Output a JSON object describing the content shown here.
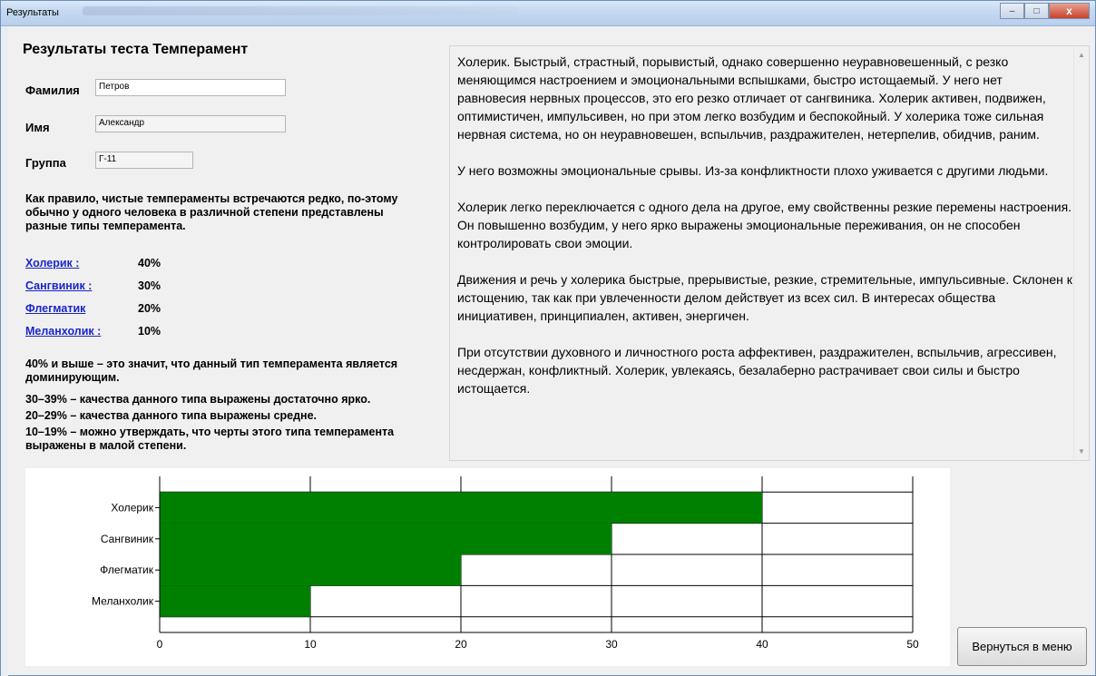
{
  "window": {
    "title": "Результаты",
    "controls": {
      "minimize": "–",
      "maximize": "□",
      "close": "x"
    }
  },
  "form": {
    "heading": "Результаты теста Темперамент",
    "surname_label": "Фамилия",
    "surname_value": "Петров",
    "name_label": "Имя",
    "name_value": "Александр",
    "group_label": "Группа",
    "group_value": "Г-11",
    "intro_note": "Как правило, чистые темпераменты встречаются редко, по-этому обычно у одного человека в различной степени представлены разные типы темперамента."
  },
  "results": [
    {
      "label": "Холерик :",
      "percent": "40%"
    },
    {
      "label": "Сангвиник :",
      "percent": "30%"
    },
    {
      "label": "Флегматик",
      "percent": "20%"
    },
    {
      "label": "Меланхолик :",
      "percent": "10%"
    }
  ],
  "legend_notes": {
    "n1": "40% и выше – это  значит, что данный тип темперамента является доминирующим.",
    "n2": "30–39% – качества данного типа выражены достаточно ярко.",
    "n3": "20–29% – качества данного типа выражены средне.",
    "n4": "10–19% – можно утверждать, что черты этого типа темперамента выражены в малой степени."
  },
  "description": {
    "p1": "Холерик. Быстрый, страстный, порывистый, однако совершенно неуравновешенный, с резко меняющимся настроением и эмоциональными вспышками, быстро истощаемый. У него нет равновесия нервных процессов, это его резко отличает от сангвиника. Холерик активен, подвижен, оптимистичен, импульсивен, но при этом легко возбудим и беспокойный. У холерика тоже сильная нервная система, но он неуравновешен, вспыльчив, раздражителен, нетерпелив, обидчив, раним.",
    "p2": "У него возможны эмоциональные срывы. Из-за конфликтности плохо уживается с другими людьми.",
    "p3": "Холерик легко переключается с одного дела на другое, ему свойственны резкие перемены настроения. Он повышенно возбудим, у него ярко выражены эмоциональные переживания, он не способен контролировать свои эмоции.",
    "p4": "Движения и речь у холерика быстрые, прерывистые, резкие, стремительные, импульсивные. Склонен к истощению, так как при увлеченности делом действует из всех сил. В интересах общества инициативен, принципиален, активен, энергичен.",
    "p5": "При отсутствии духовного и личностного роста аффективен, раздражителен, вспыльчив, агрессивен, несдержан, конфликтный. Холерик, увлекаясь, безалаберно растрачивает свои силы и быстро истощается."
  },
  "back_button": "Вернуться в меню",
  "chart_data": {
    "type": "bar",
    "orientation": "horizontal",
    "categories": [
      "Холерик",
      "Сангвиник",
      "Флегматик",
      "Меланхолик"
    ],
    "values": [
      40,
      30,
      20,
      10
    ],
    "xlim": [
      0,
      50
    ],
    "xticks": [
      0,
      10,
      20,
      30,
      40,
      50
    ],
    "grid": true,
    "bar_color": "#008000",
    "title": "",
    "xlabel": "",
    "ylabel": ""
  }
}
